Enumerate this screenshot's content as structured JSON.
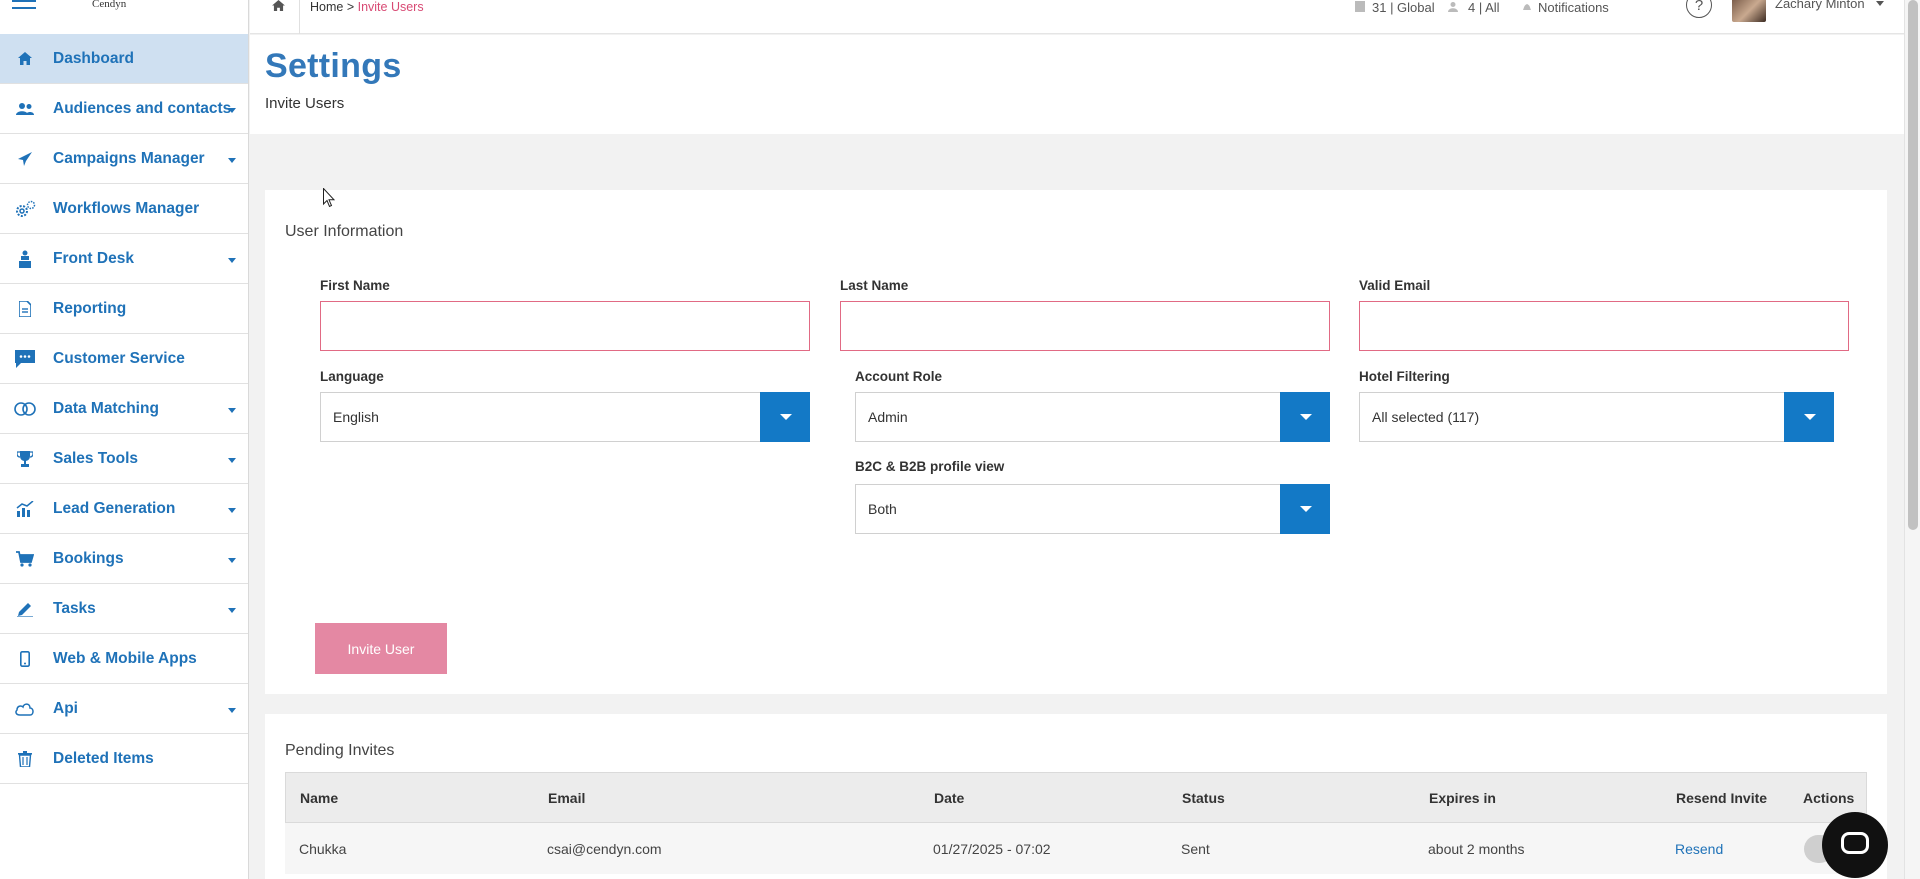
{
  "brand": {
    "logo_text": "Cendyn",
    "accent": "#1f72b8",
    "button": "#1379c6"
  },
  "sidebar": {
    "items": [
      {
        "label": "Dashboard",
        "icon": "home-icon",
        "active": true,
        "caret": false
      },
      {
        "label": "Audiences and contacts",
        "icon": "users-icon",
        "caret": true
      },
      {
        "label": "Campaigns Manager",
        "icon": "paper-plane-icon",
        "caret": true
      },
      {
        "label": "Workflows Manager",
        "icon": "gears-icon",
        "caret": false
      },
      {
        "label": "Front Desk",
        "icon": "bellhop-icon",
        "caret": true
      },
      {
        "label": "Reporting",
        "icon": "document-icon",
        "caret": false
      },
      {
        "label": "Customer Service",
        "icon": "chat-icon",
        "caret": false
      },
      {
        "label": "Data Matching",
        "icon": "rings-icon",
        "caret": true
      },
      {
        "label": "Sales Tools",
        "icon": "trophy-icon",
        "caret": true
      },
      {
        "label": "Lead Generation",
        "icon": "chart-growth-icon",
        "caret": true
      },
      {
        "label": "Bookings",
        "icon": "cart-icon",
        "caret": true
      },
      {
        "label": "Tasks",
        "icon": "pencil-icon",
        "caret": true
      },
      {
        "label": "Web & Mobile Apps",
        "icon": "mobile-icon",
        "caret": false
      },
      {
        "label": "Api",
        "icon": "cloud-icon",
        "caret": true
      },
      {
        "label": "Deleted Items",
        "icon": "trash-icon",
        "caret": false
      }
    ]
  },
  "topbar": {
    "breadcrumb_home": "Home",
    "breadcrumb_sep": " > ",
    "breadcrumb_current": "Invite Users",
    "hotels": "31 | Global",
    "users": "4 | All",
    "notifications": "Notifications",
    "help": "?",
    "user_name": "Zachary Minton"
  },
  "header": {
    "title": "Settings",
    "subtitle": "Invite Users"
  },
  "form": {
    "section_title": "User Information",
    "first_name_label": "First Name",
    "last_name_label": "Last Name",
    "email_label": "Valid Email",
    "language_label": "Language",
    "language_value": "English",
    "role_label": "Account Role",
    "role_value": "Admin",
    "hotel_label": "Hotel Filtering",
    "hotel_value": "All selected (117)",
    "profile_label": "B2C & B2B profile view",
    "profile_value": "Both",
    "invite_button": "Invite User"
  },
  "pending": {
    "title": "Pending Invites",
    "columns": [
      "Name",
      "Email",
      "Date",
      "Status",
      "Expires in",
      "Resend Invite",
      "Actions"
    ],
    "rows": [
      {
        "name": "Chukka",
        "email": "csai@cendyn.com",
        "date": "01/27/2025 - 07:02",
        "status": "Sent",
        "expires": "about 2 months",
        "resend": "Resend"
      }
    ]
  }
}
